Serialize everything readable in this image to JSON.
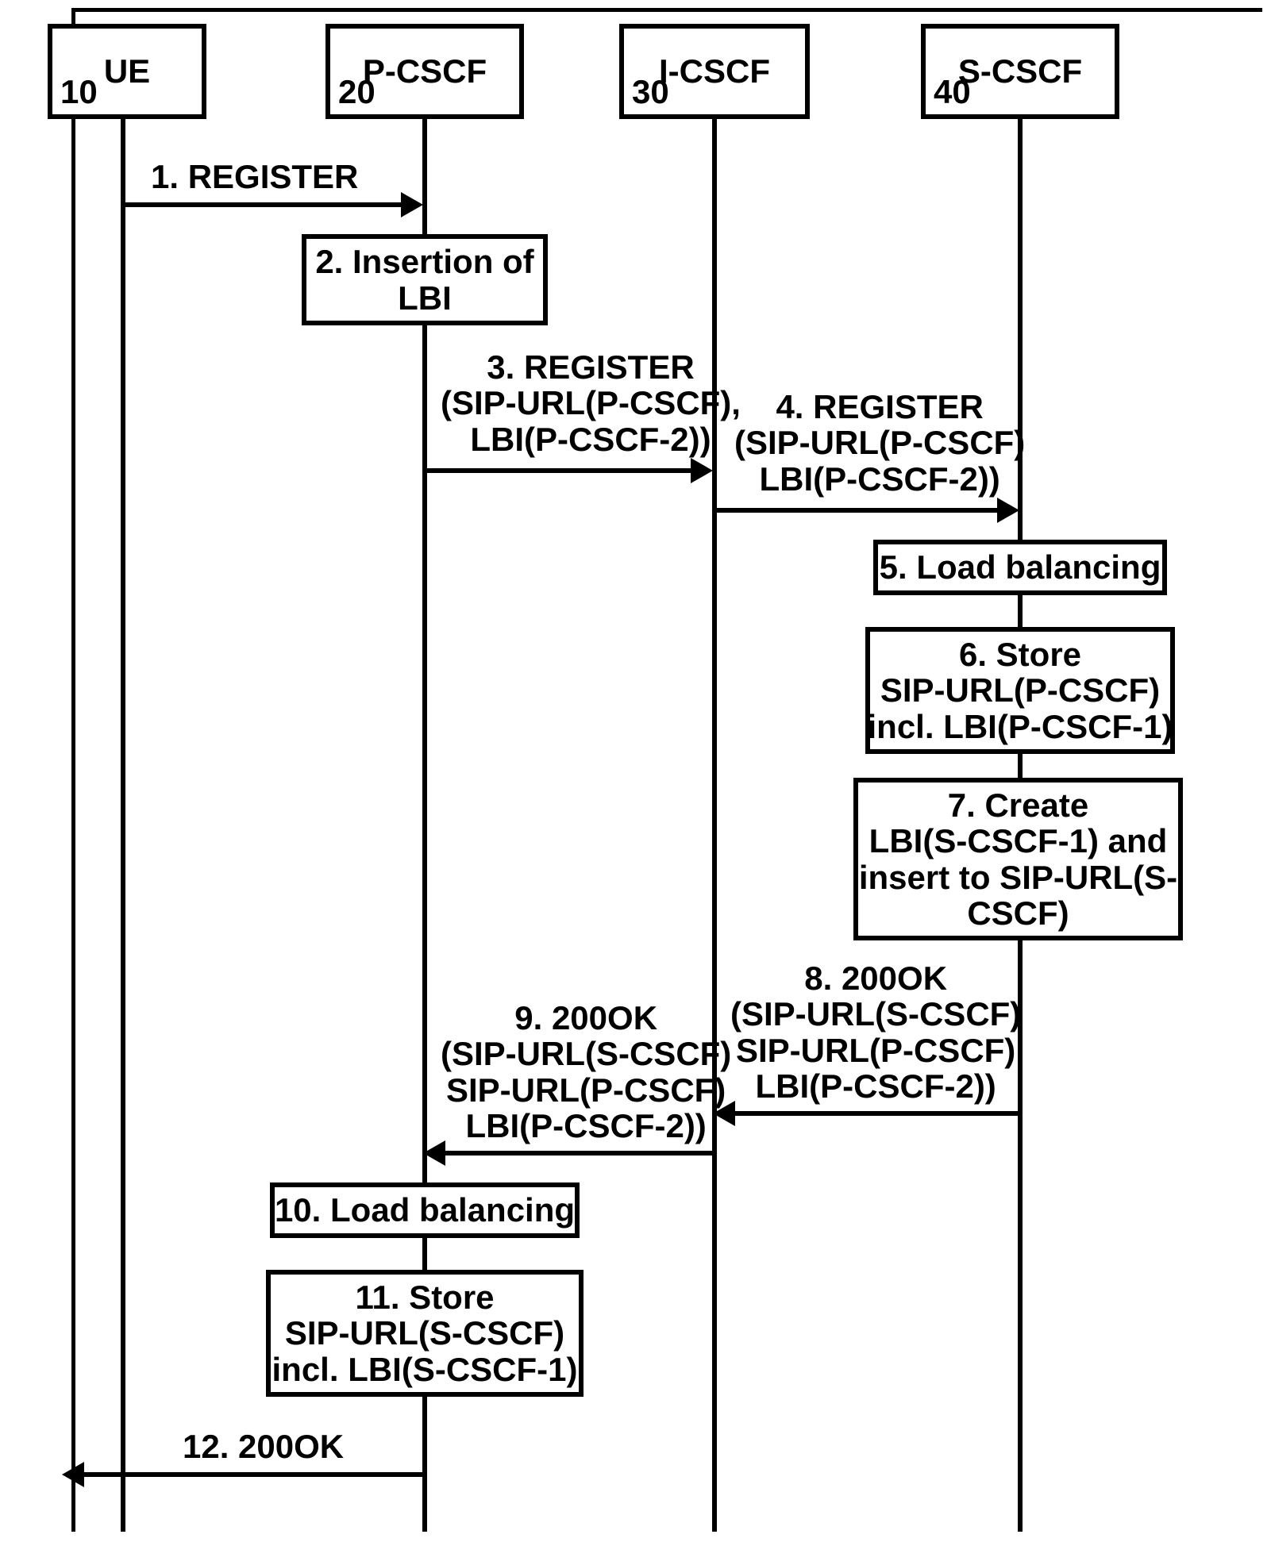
{
  "actors": {
    "ue": {
      "title": "UE",
      "num": "10"
    },
    "pcscf": {
      "title": "P-CSCF",
      "num": "20"
    },
    "icscf": {
      "title": "I-CSCF",
      "num": "30"
    },
    "scscf": {
      "title": "S-CSCF",
      "num": "40"
    }
  },
  "messages": {
    "m1": "1. REGISTER",
    "m3": "3. REGISTER\n(SIP-URL(P-CSCF),\nLBI(P-CSCF-2))",
    "m4": "4. REGISTER\n(SIP-URL(P-CSCF)\nLBI(P-CSCF-2))",
    "m8": "8. 200OK\n(SIP-URL(S-CSCF)\nSIP-URL(P-CSCF)\nLBI(P-CSCF-2))",
    "m9": "9. 200OK\n(SIP-URL(S-CSCF)\nSIP-URL(P-CSCF)\nLBI(P-CSCF-2))",
    "m12": "12. 200OK"
  },
  "steps": {
    "s2": "2. Insertion of\nLBI",
    "s5": "5. Load balancing",
    "s6": "6. Store\nSIP-URL(P-CSCF)\nincl. LBI(P-CSCF-1)",
    "s7": "7. Create\nLBI(S-CSCF-1) and\ninsert to SIP-URL(S-\nCSCF)",
    "s10": "10. Load balancing",
    "s11": "11. Store\nSIP-URL(S-CSCF)\nincl. LBI(S-CSCF-1)"
  }
}
